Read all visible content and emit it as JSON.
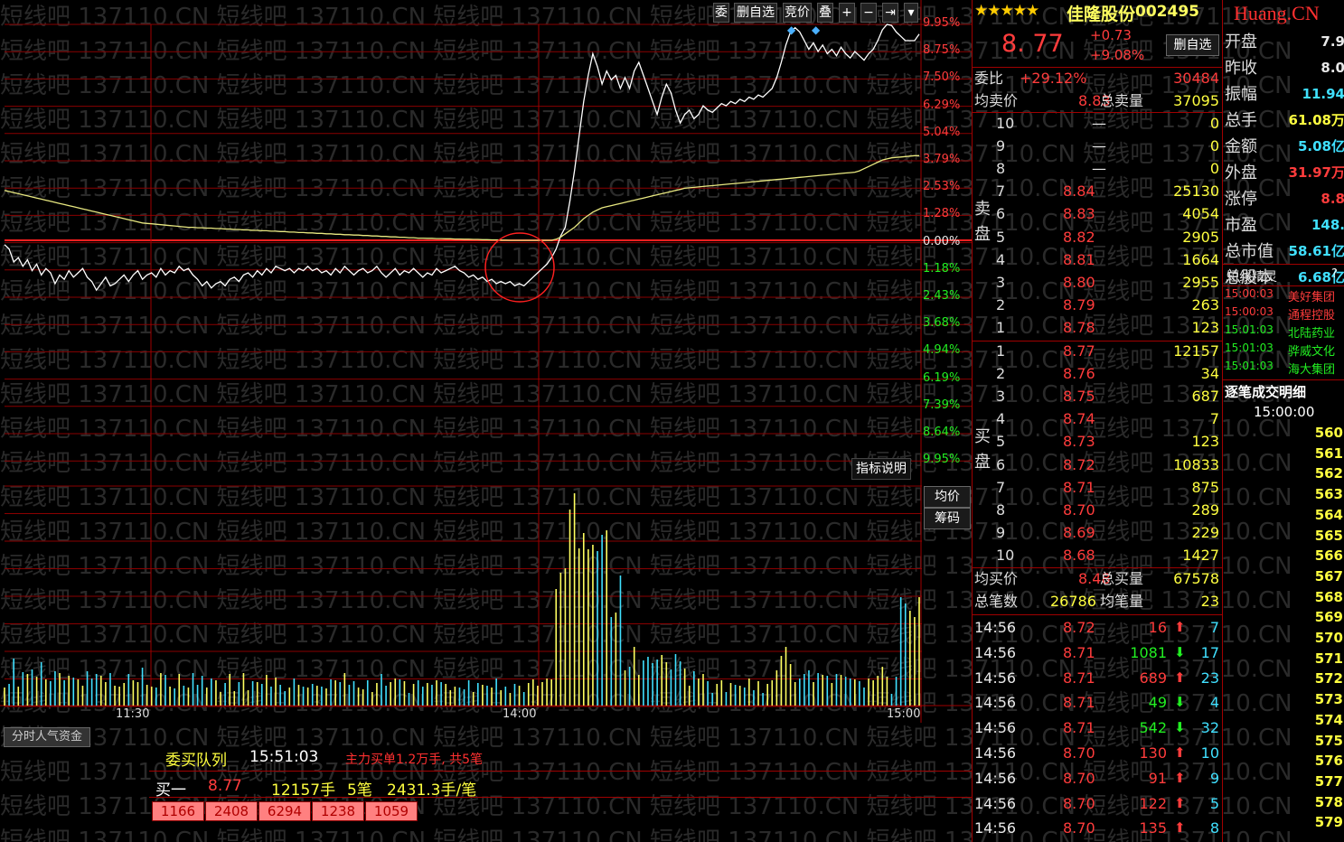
{
  "toolbar": {
    "buttons": [
      "委",
      "删自选",
      "竞价",
      "叠",
      "+",
      "−",
      "⇥",
      "▾"
    ]
  },
  "chart_axis": {
    "pct_up": [
      "9.95%",
      "8.75%",
      "7.50%",
      "6.29%",
      "5.04%",
      "3.79%",
      "2.53%",
      "1.28%"
    ],
    "zero": "0.00%",
    "pct_down": [
      "1.18%",
      "2.43%",
      "3.68%",
      "4.94%",
      "6.19%",
      "7.39%",
      "8.64%",
      "9.95%"
    ],
    "time_ticks": [
      "11:30",
      "14:00",
      "15:00"
    ],
    "indicator_link": "指标说明",
    "side_btn_avg": "均价",
    "side_btn_chip": "筹码",
    "bottom_tab": "分时人气资金"
  },
  "chart_data": {
    "type": "line",
    "x_range": [
      0,
      240
    ],
    "ylim_pct": [
      -9.95,
      9.95
    ],
    "series": [
      {
        "values": [
          -0.2,
          -0.4,
          -1.0,
          -0.8,
          -1.2,
          -0.9,
          -1.4,
          -1.1,
          -1.6,
          -1.3,
          -1.5,
          -2.0,
          -1.6,
          -1.8,
          -1.4,
          -1.7,
          -1.5,
          -1.3,
          -1.7,
          -1.9,
          -2.3,
          -2.0,
          -1.7,
          -2.1,
          -2.0,
          -1.8,
          -1.6,
          -1.9,
          -1.6,
          -1.4,
          -1.8,
          -1.6,
          -1.5,
          -1.7,
          -1.3,
          -1.6,
          -1.4,
          -1.5,
          -1.2,
          -1.4,
          -1.3,
          -1.6,
          -1.8,
          -2.1,
          -1.9,
          -2.2,
          -2.0,
          -1.9,
          -2.1,
          -1.8,
          -1.7,
          -1.9,
          -1.6,
          -1.5,
          -1.7,
          -1.4,
          -1.6,
          -1.3,
          -1.5,
          -1.2,
          -1.3,
          -1.4,
          -1.3,
          -1.5,
          -1.3,
          -1.4,
          -1.2,
          -1.4,
          -1.3,
          -1.5,
          -1.4,
          -1.6,
          -1.3,
          -1.5,
          -1.2,
          -1.4,
          -1.6,
          -1.4,
          -1.3,
          -1.5,
          -1.4,
          -1.2,
          -1.5,
          -1.7,
          -1.5,
          -1.3,
          -1.6,
          -1.4,
          -1.5,
          -1.3,
          -1.5,
          -1.7,
          -1.5,
          -1.6,
          -1.3,
          -1.5,
          -1.4,
          -1.3,
          -1.2,
          -1.4,
          -1.5,
          -1.7,
          -1.6,
          -1.8,
          -1.7,
          -1.9,
          -1.8,
          -2.0,
          -1.9,
          -2.0,
          -1.9,
          -2.1,
          -2.0,
          -2.1,
          -1.9,
          -1.7,
          -1.5,
          -1.3,
          -1.1,
          -0.8,
          -0.4,
          0.2,
          0.6,
          1.8,
          3.2,
          4.8,
          6.4,
          7.6,
          8.6,
          8.0,
          7.2,
          7.8,
          7.4,
          7.6,
          7.0,
          7.5,
          7.0,
          7.8,
          8.2,
          7.6,
          7.0,
          6.4,
          5.8,
          6.6,
          7.2,
          6.8,
          6.0,
          5.4,
          5.8,
          6.0,
          5.6,
          5.8,
          6.2,
          6.0,
          5.9,
          6.1,
          6.3,
          6.2,
          6.4,
          6.3,
          6.5,
          6.4,
          6.6,
          6.5,
          6.7,
          6.6,
          6.8,
          7.0,
          7.5,
          8.2,
          9.0,
          9.6,
          9.8,
          9.6,
          9.2,
          8.8,
          9.1,
          8.7,
          9.0,
          8.6,
          8.8,
          8.5,
          8.9,
          8.6,
          8.4,
          8.7,
          8.5,
          8.3,
          8.6,
          8.8,
          9.2,
          9.7,
          9.95,
          9.9,
          9.6,
          9.4,
          9.2,
          9.2,
          9.2,
          9.5
        ]
      },
      {
        "values": [
          2.3,
          2.25,
          2.2,
          2.15,
          2.1,
          2.05,
          2.0,
          1.95,
          1.9,
          1.85,
          1.8,
          1.75,
          1.7,
          1.65,
          1.6,
          1.55,
          1.5,
          1.45,
          1.4,
          1.35,
          1.3,
          1.25,
          1.2,
          1.15,
          1.1,
          1.05,
          1.0,
          0.95,
          0.9,
          0.85,
          0.8,
          0.78,
          0.76,
          0.74,
          0.72,
          0.7,
          0.68,
          0.66,
          0.64,
          0.62,
          0.6,
          0.6,
          0.58,
          0.58,
          0.56,
          0.56,
          0.54,
          0.54,
          0.52,
          0.52,
          0.5,
          0.5,
          0.48,
          0.48,
          0.46,
          0.46,
          0.44,
          0.44,
          0.42,
          0.42,
          0.4,
          0.4,
          0.38,
          0.38,
          0.36,
          0.36,
          0.34,
          0.34,
          0.32,
          0.32,
          0.3,
          0.3,
          0.28,
          0.28,
          0.26,
          0.26,
          0.24,
          0.24,
          0.22,
          0.22,
          0.2,
          0.2,
          0.18,
          0.18,
          0.16,
          0.16,
          0.14,
          0.14,
          0.12,
          0.12,
          0.1,
          0.1,
          0.09,
          0.09,
          0.08,
          0.08,
          0.07,
          0.07,
          0.06,
          0.06,
          0.05,
          0.05,
          0.04,
          0.04,
          0.03,
          0.03,
          0.02,
          0.02,
          0.01,
          0.01,
          0.0,
          0.0,
          0.0,
          0.0,
          0.0,
          0.0,
          0.0,
          0.0,
          0.0,
          0.0,
          0.05,
          0.15,
          0.3,
          0.45,
          0.6,
          0.8,
          1.0,
          1.15,
          1.3,
          1.4,
          1.5,
          1.55,
          1.6,
          1.65,
          1.7,
          1.75,
          1.8,
          1.85,
          1.9,
          1.95,
          2.0,
          2.05,
          2.1,
          2.15,
          2.2,
          2.25,
          2.3,
          2.35,
          2.4,
          2.42,
          2.44,
          2.46,
          2.48,
          2.5,
          2.52,
          2.54,
          2.56,
          2.58,
          2.6,
          2.62,
          2.64,
          2.66,
          2.68,
          2.7,
          2.72,
          2.74,
          2.76,
          2.78,
          2.8,
          2.82,
          2.84,
          2.86,
          2.88,
          2.9,
          2.92,
          2.94,
          2.96,
          2.98,
          3.0,
          3.02,
          3.04,
          3.06,
          3.08,
          3.1,
          3.12,
          3.14,
          3.2,
          3.3,
          3.4,
          3.5,
          3.6,
          3.7,
          3.75,
          3.8,
          3.82,
          3.84,
          3.86,
          3.88,
          3.9,
          3.9
        ]
      }
    ]
  },
  "stock": {
    "stars": "★★★★★",
    "name": "佳隆股份",
    "code": "002495",
    "price": "8. 77",
    "change": "+0.73",
    "change_pct": "+9.08%",
    "del_fav": "删自选"
  },
  "summary": {
    "weibi_label": "委比",
    "weibi_pct": "+29.12%",
    "weibi_val": "30484",
    "avg_sell_label": "均卖价",
    "avg_sell": "8.83",
    "total_sell_label": "总卖量",
    "total_sell": "37095",
    "avg_buy_label": "均买价",
    "avg_buy": "8.48",
    "total_buy_label": "总买量",
    "total_buy": "67578",
    "total_trades_label": "总笔数",
    "total_trades": "26786",
    "avg_trade_label": "均笔量",
    "avg_trade": "23"
  },
  "sell_label": [
    "卖",
    "盘"
  ],
  "buy_label": [
    "买",
    "盘"
  ],
  "asks": [
    {
      "lvl": "10",
      "price": "—",
      "vol": "0"
    },
    {
      "lvl": "9",
      "price": "—",
      "vol": "0"
    },
    {
      "lvl": "8",
      "price": "—",
      "vol": "0"
    },
    {
      "lvl": "7",
      "price": "8.84",
      "vol": "25130"
    },
    {
      "lvl": "6",
      "price": "8.83",
      "vol": "4054"
    },
    {
      "lvl": "5",
      "price": "8.82",
      "vol": "2905"
    },
    {
      "lvl": "4",
      "price": "8.81",
      "vol": "1664"
    },
    {
      "lvl": "3",
      "price": "8.80",
      "vol": "2955"
    },
    {
      "lvl": "2",
      "price": "8.79",
      "vol": "263"
    },
    {
      "lvl": "1",
      "price": "8.78",
      "vol": "123"
    }
  ],
  "bids": [
    {
      "lvl": "1",
      "price": "8.77",
      "vol": "12157"
    },
    {
      "lvl": "2",
      "price": "8.76",
      "vol": "34"
    },
    {
      "lvl": "3",
      "price": "8.75",
      "vol": "687"
    },
    {
      "lvl": "4",
      "price": "8.74",
      "vol": "7"
    },
    {
      "lvl": "5",
      "price": "8.73",
      "vol": "123"
    },
    {
      "lvl": "6",
      "price": "8.72",
      "vol": "10833"
    },
    {
      "lvl": "7",
      "price": "8.71",
      "vol": "875"
    },
    {
      "lvl": "8",
      "price": "8.70",
      "vol": "289"
    },
    {
      "lvl": "9",
      "price": "8.69",
      "vol": "229"
    },
    {
      "lvl": "10",
      "price": "8.68",
      "vol": "1427"
    }
  ],
  "trades": [
    {
      "time": "14:56",
      "price": "8.72",
      "vol": "16",
      "dir": "up",
      "n": "7"
    },
    {
      "time": "14:56",
      "price": "8.71",
      "vol": "1081",
      "dir": "dn",
      "n": "17"
    },
    {
      "time": "14:56",
      "price": "8.71",
      "vol": "689",
      "dir": "up",
      "n": "23"
    },
    {
      "time": "14:56",
      "price": "8.71",
      "vol": "49",
      "dir": "dn",
      "n": "4"
    },
    {
      "time": "14:56",
      "price": "8.71",
      "vol": "542",
      "dir": "dn",
      "n": "32"
    },
    {
      "time": "14:56",
      "price": "8.70",
      "vol": "130",
      "dir": "up",
      "n": "10"
    },
    {
      "time": "14:56",
      "price": "8.70",
      "vol": "91",
      "dir": "up",
      "n": "9"
    },
    {
      "time": "14:56",
      "price": "8.70",
      "vol": "122",
      "dir": "up",
      "n": "5"
    },
    {
      "time": "14:56",
      "price": "8.70",
      "vol": "135",
      "dir": "up",
      "n": "8"
    }
  ],
  "watermark_site": "Huang.CN",
  "stats": [
    {
      "label": "开盘",
      "val": "7.9"
    },
    {
      "label": "昨收",
      "val": "8.0"
    },
    {
      "label": "振幅",
      "val": "11.94"
    },
    {
      "label": "总手",
      "val": "61.08万"
    },
    {
      "label": "金额",
      "val": "5.08亿"
    },
    {
      "label": "外盘",
      "val": "31.97万"
    },
    {
      "label": "涨停",
      "val": "8.8"
    },
    {
      "label": "市盈",
      "val": "148."
    },
    {
      "label": "总市值",
      "val": "58.61亿"
    },
    {
      "label": "总股本",
      "val": "6.68亿"
    }
  ],
  "spirit": {
    "title": "短线精灵",
    "help": "?",
    "items": [
      {
        "time": "15:00:03",
        "name": "美好集团",
        "color": "up"
      },
      {
        "time": "15:00:03",
        "name": "通程控股",
        "color": "up"
      },
      {
        "time": "15:01:03",
        "name": "北陆药业",
        "color": "dn"
      },
      {
        "time": "15:01:03",
        "name": "骅威文化",
        "color": "dn"
      },
      {
        "time": "15:01:03",
        "name": "海大集团",
        "color": "dn"
      }
    ]
  },
  "tick_detail": {
    "title": "逐笔成交明细",
    "time": "15:00:00",
    "ids": [
      "560",
      "561",
      "562",
      "563",
      "564",
      "565",
      "566",
      "567",
      "568",
      "569",
      "570",
      "571",
      "572",
      "573",
      "574",
      "575",
      "576",
      "577",
      "578",
      "579"
    ]
  },
  "queue": {
    "title": "委买队列",
    "time": "15:51:03",
    "note": "主力买单1.2万手, 共5笔",
    "level": "买一",
    "price": "8.77",
    "hands": "12157手",
    "count": "5笔",
    "avg": "2431.3手/笔",
    "orders": [
      "1166",
      "2408",
      "6294",
      "1238",
      "1059"
    ]
  },
  "watermark": "短线吧 137110.CN",
  "colors": {
    "up": "#ff3c3c",
    "down": "#22ee22",
    "grid": "#a00000",
    "price_line": "#ffffff",
    "avg_line": "#e8e880",
    "vol_up": "#ffff60",
    "vol_dn": "#40e0ff"
  }
}
